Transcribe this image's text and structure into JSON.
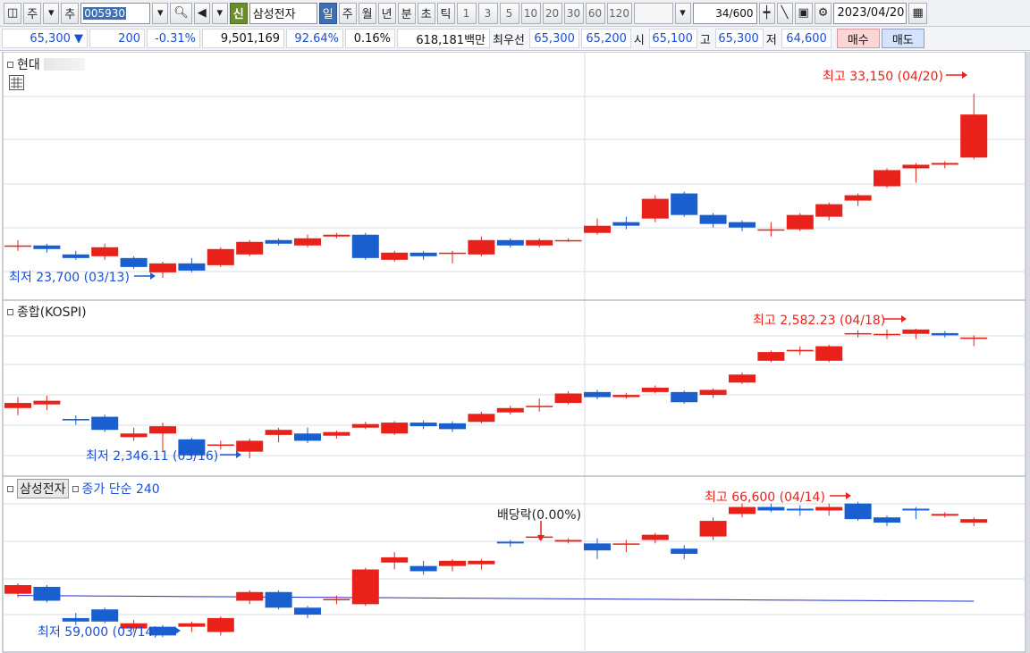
{
  "toolbar": {
    "market": "주",
    "add": "추",
    "code": "005930",
    "new_badge": "신",
    "stock_name": "삼성전자",
    "periods": [
      "일",
      "주",
      "월",
      "년",
      "분",
      "초",
      "틱"
    ],
    "intervals": [
      "1",
      "3",
      "5",
      "10",
      "20",
      "30",
      "60",
      "120"
    ],
    "count": "34/600",
    "date": "2023/04/20"
  },
  "quote": {
    "price": "65,300 ▼",
    "change": "200",
    "change_pct": "-0.31%",
    "volume": "9,501,169",
    "vol_ratio": "92.64%",
    "turnover": "0.16%",
    "amount": "618,181백만",
    "best_label": "최우선",
    "ask": "65,300",
    "bid": "65,200",
    "open_label": "시",
    "open": "65,100",
    "high_label": "고",
    "high": "65,300",
    "low_label": "저",
    "low": "64,600",
    "buy": "매수",
    "sell": "매도"
  },
  "colors": {
    "up": "#e8221a",
    "down": "#1a5fd0",
    "ma": "#2a2ad0",
    "grid": "#d8dce3"
  },
  "panels": [
    {
      "title": "현대",
      "high_label": "최고 33,150 (04/20)",
      "low_label": "최저 23,700 (03/13)"
    },
    {
      "title": "종합(KOSPI)",
      "high_label": "최고 2,582.23 (04/18)",
      "low_label": "최저 2,346.11 (03/16)"
    },
    {
      "title": "삼성전자",
      "ma_label": "종가 단순 240",
      "high_label": "최고 66,600 (04/14)",
      "low_label": "최저 59,000 (03/14)",
      "dividend_label": "배당락(0.00%)"
    }
  ],
  "chart_data": [
    {
      "type": "candlestick",
      "title": "현대",
      "candles": [
        {
          "o": 24700,
          "c": 24700,
          "h": 25000,
          "l": 24400
        },
        {
          "o": 24700,
          "c": 24500,
          "h": 24800,
          "l": 24300
        },
        {
          "o": 24200,
          "c": 24000,
          "h": 24400,
          "l": 23900
        },
        {
          "o": 24100,
          "c": 24600,
          "h": 24800,
          "l": 23900
        },
        {
          "o": 24000,
          "c": 23500,
          "h": 24100,
          "l": 23400
        },
        {
          "o": 23200,
          "c": 23700,
          "h": 23800,
          "l": 22900
        },
        {
          "o": 23700,
          "c": 23300,
          "h": 24000,
          "l": 23200
        },
        {
          "o": 23600,
          "c": 24500,
          "h": 24600,
          "l": 23500
        },
        {
          "o": 24200,
          "c": 24900,
          "h": 25000,
          "l": 24100
        },
        {
          "o": 25000,
          "c": 24800,
          "h": 25100,
          "l": 24700
        },
        {
          "o": 24700,
          "c": 25100,
          "h": 25300,
          "l": 24600
        },
        {
          "o": 25200,
          "c": 25300,
          "h": 25400,
          "l": 25100
        },
        {
          "o": 25300,
          "c": 24000,
          "h": 25400,
          "l": 23900
        },
        {
          "o": 23900,
          "c": 24300,
          "h": 24400,
          "l": 23800
        },
        {
          "o": 24300,
          "c": 24100,
          "h": 24400,
          "l": 23900
        },
        {
          "o": 24300,
          "c": 24300,
          "h": 24400,
          "l": 23700
        },
        {
          "o": 24200,
          "c": 25000,
          "h": 25200,
          "l": 24100
        },
        {
          "o": 25000,
          "c": 24700,
          "h": 25100,
          "l": 24600
        },
        {
          "o": 24700,
          "c": 25000,
          "h": 25100,
          "l": 24600
        },
        {
          "o": 25000,
          "c": 25000,
          "h": 25100,
          "l": 24900
        },
        {
          "o": 25400,
          "c": 25800,
          "h": 26200,
          "l": 25300
        },
        {
          "o": 26000,
          "c": 25800,
          "h": 26300,
          "l": 25600
        },
        {
          "o": 26200,
          "c": 27300,
          "h": 27500,
          "l": 26000
        },
        {
          "o": 27600,
          "c": 26400,
          "h": 27700,
          "l": 26300
        },
        {
          "o": 26400,
          "c": 25900,
          "h": 26500,
          "l": 25700
        },
        {
          "o": 26000,
          "c": 25700,
          "h": 26100,
          "l": 25500
        },
        {
          "o": 25600,
          "c": 25600,
          "h": 26000,
          "l": 25200
        },
        {
          "o": 25600,
          "c": 26400,
          "h": 26500,
          "l": 25500
        },
        {
          "o": 26300,
          "c": 27000,
          "h": 27100,
          "l": 26100
        },
        {
          "o": 27200,
          "c": 27500,
          "h": 27600,
          "l": 26900
        },
        {
          "o": 28000,
          "c": 28900,
          "h": 29000,
          "l": 27900
        },
        {
          "o": 29000,
          "c": 29200,
          "h": 29300,
          "l": 28200
        },
        {
          "o": 29200,
          "c": 29300,
          "h": 29400,
          "l": 29000
        },
        {
          "o": 29600,
          "c": 32000,
          "h": 33150,
          "l": 29500
        }
      ],
      "ylim": [
        22000,
        34500
      ]
    },
    {
      "type": "candlestick",
      "title": "종합(KOSPI)",
      "candles": [
        {
          "o": 2405,
          "c": 2412,
          "h": 2420,
          "l": 2395
        },
        {
          "o": 2410,
          "c": 2415,
          "h": 2422,
          "l": 2402
        },
        {
          "o": 2390,
          "c": 2388,
          "h": 2395,
          "l": 2382
        },
        {
          "o": 2393,
          "c": 2375,
          "h": 2396,
          "l": 2372
        },
        {
          "o": 2365,
          "c": 2370,
          "h": 2378,
          "l": 2360
        },
        {
          "o": 2370,
          "c": 2380,
          "h": 2385,
          "l": 2346
        },
        {
          "o": 2362,
          "c": 2340,
          "h": 2364,
          "l": 2338
        },
        {
          "o": 2355,
          "c": 2355,
          "h": 2360,
          "l": 2348
        },
        {
          "o": 2345,
          "c": 2360,
          "h": 2363,
          "l": 2336
        },
        {
          "o": 2368,
          "c": 2375,
          "h": 2378,
          "l": 2358
        },
        {
          "o": 2370,
          "c": 2360,
          "h": 2378,
          "l": 2357
        },
        {
          "o": 2367,
          "c": 2372,
          "h": 2374,
          "l": 2363
        },
        {
          "o": 2378,
          "c": 2383,
          "h": 2386,
          "l": 2376
        },
        {
          "o": 2370,
          "c": 2385,
          "h": 2387,
          "l": 2368
        },
        {
          "o": 2385,
          "c": 2380,
          "h": 2388,
          "l": 2376
        },
        {
          "o": 2384,
          "c": 2376,
          "h": 2387,
          "l": 2372
        },
        {
          "o": 2386,
          "c": 2397,
          "h": 2400,
          "l": 2384
        },
        {
          "o": 2399,
          "c": 2405,
          "h": 2408,
          "l": 2396
        },
        {
          "o": 2408,
          "c": 2408,
          "h": 2418,
          "l": 2400
        },
        {
          "o": 2412,
          "c": 2425,
          "h": 2428,
          "l": 2410
        },
        {
          "o": 2427,
          "c": 2420,
          "h": 2430,
          "l": 2417
        },
        {
          "o": 2420,
          "c": 2423,
          "h": 2426,
          "l": 2418
        },
        {
          "o": 2427,
          "c": 2433,
          "h": 2436,
          "l": 2425
        },
        {
          "o": 2427,
          "c": 2413,
          "h": 2429,
          "l": 2411
        },
        {
          "o": 2423,
          "c": 2430,
          "h": 2432,
          "l": 2419
        },
        {
          "o": 2440,
          "c": 2451,
          "h": 2454,
          "l": 2438
        },
        {
          "o": 2470,
          "c": 2482,
          "h": 2484,
          "l": 2468
        },
        {
          "o": 2483,
          "c": 2485,
          "h": 2490,
          "l": 2478
        },
        {
          "o": 2470,
          "c": 2490,
          "h": 2492,
          "l": 2468
        },
        {
          "o": 2508,
          "c": 2508,
          "h": 2512,
          "l": 2502
        },
        {
          "o": 2507,
          "c": 2507,
          "h": 2513,
          "l": 2500
        },
        {
          "o": 2507,
          "c": 2513,
          "h": 2514,
          "l": 2500
        },
        {
          "o": 2508,
          "c": 2505,
          "h": 2511,
          "l": 2502
        },
        {
          "o": 2500,
          "c": 2502,
          "h": 2505,
          "l": 2490
        }
      ],
      "ylim": [
        2320,
        2530
      ]
    },
    {
      "type": "candlestick",
      "title": "삼성전자",
      "series": [
        {
          "name": "종가 단순 240",
          "values": [
            61300,
            61290,
            61280,
            61270,
            61260,
            61250,
            61240,
            61230,
            61220,
            61210,
            61200,
            61190,
            61180,
            61170,
            61160,
            61150,
            61140,
            61130,
            61120,
            61110,
            61100,
            61090,
            61080,
            61070,
            61060,
            61050,
            61040,
            61030,
            61020,
            61010,
            61000,
            60990,
            60980,
            60970
          ]
        }
      ],
      "candles": [
        {
          "o": 61400,
          "c": 61900,
          "h": 62000,
          "l": 61200
        },
        {
          "o": 61800,
          "c": 61000,
          "h": 61900,
          "l": 60900
        },
        {
          "o": 60000,
          "c": 59800,
          "h": 60300,
          "l": 59600
        },
        {
          "o": 60500,
          "c": 59800,
          "h": 60600,
          "l": 59700
        },
        {
          "o": 59400,
          "c": 59700,
          "h": 59900,
          "l": 59200
        },
        {
          "o": 59500,
          "c": 59000,
          "h": 59600,
          "l": 58900
        },
        {
          "o": 59500,
          "c": 59700,
          "h": 59800,
          "l": 59200
        },
        {
          "o": 59200,
          "c": 60000,
          "h": 60100,
          "l": 59000
        },
        {
          "o": 61000,
          "c": 61500,
          "h": 61600,
          "l": 60800
        },
        {
          "o": 61500,
          "c": 60600,
          "h": 61600,
          "l": 60500
        },
        {
          "o": 60600,
          "c": 60200,
          "h": 60700,
          "l": 60000
        },
        {
          "o": 61100,
          "c": 61100,
          "h": 61300,
          "l": 60800
        },
        {
          "o": 60800,
          "c": 62800,
          "h": 62900,
          "l": 60700
        },
        {
          "o": 63200,
          "c": 63500,
          "h": 63800,
          "l": 62800
        },
        {
          "o": 63000,
          "c": 62700,
          "h": 63300,
          "l": 62500
        },
        {
          "o": 63000,
          "c": 63300,
          "h": 63400,
          "l": 62700
        },
        {
          "o": 63100,
          "c": 63300,
          "h": 63400,
          "l": 62800
        },
        {
          "o": 64400,
          "c": 64300,
          "h": 64500,
          "l": 64100
        },
        {
          "o": 64700,
          "c": 64700,
          "h": 64800,
          "l": 64500
        },
        {
          "o": 64400,
          "c": 64500,
          "h": 64600,
          "l": 64300
        },
        {
          "o": 64300,
          "c": 63900,
          "h": 64600,
          "l": 63400
        },
        {
          "o": 64300,
          "c": 64300,
          "h": 64500,
          "l": 63800
        },
        {
          "o": 64500,
          "c": 64800,
          "h": 64900,
          "l": 64300
        },
        {
          "o": 64000,
          "c": 63700,
          "h": 64200,
          "l": 63400
        },
        {
          "o": 64700,
          "c": 65600,
          "h": 65800,
          "l": 64500
        },
        {
          "o": 66000,
          "c": 66400,
          "h": 66600,
          "l": 65800
        },
        {
          "o": 66400,
          "c": 66200,
          "h": 66600,
          "l": 66100
        },
        {
          "o": 66300,
          "c": 66200,
          "h": 66500,
          "l": 65900
        },
        {
          "o": 66200,
          "c": 66400,
          "h": 66600,
          "l": 65900
        },
        {
          "o": 66600,
          "c": 65700,
          "h": 66700,
          "l": 65600
        },
        {
          "o": 65800,
          "c": 65500,
          "h": 65900,
          "l": 65300
        },
        {
          "o": 66300,
          "c": 66200,
          "h": 66400,
          "l": 65700
        },
        {
          "o": 65900,
          "c": 66000,
          "h": 66100,
          "l": 65800
        },
        {
          "o": 65500,
          "c": 65700,
          "h": 65800,
          "l": 65300
        }
      ],
      "ylim": [
        58400,
        67200
      ]
    }
  ]
}
